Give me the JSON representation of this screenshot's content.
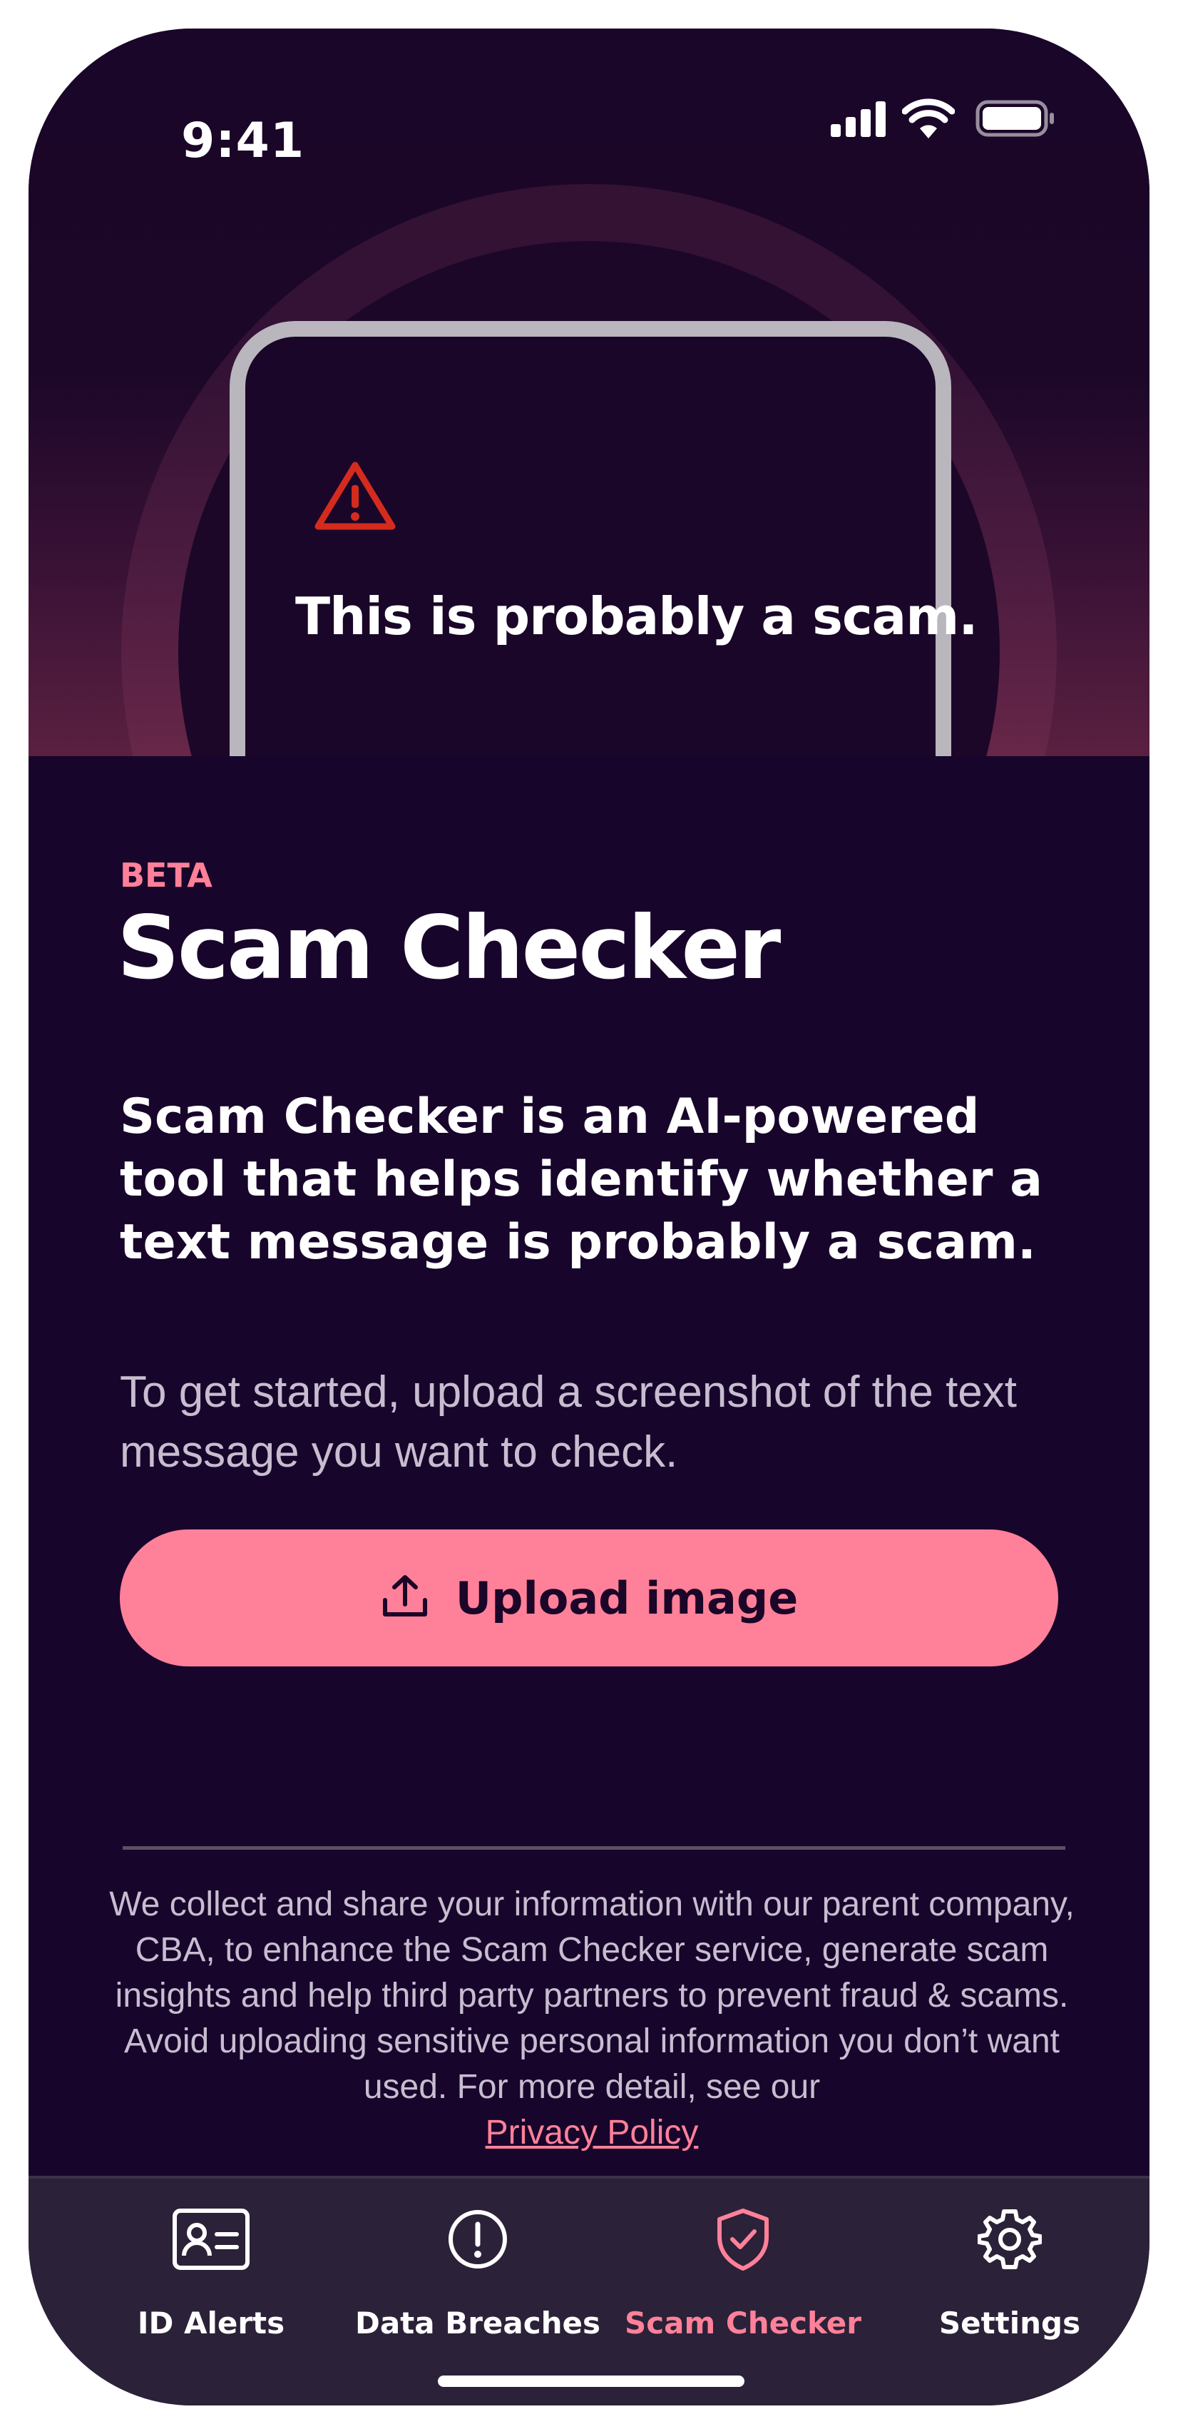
{
  "status_bar": {
    "time": "9:41"
  },
  "hero": {
    "message": "This is probably a scam."
  },
  "content": {
    "badge": "BETA",
    "title": "Scam Checker",
    "description": "Scam Checker is an AI-powered tool that helps identify whether a text message is probably a scam.",
    "instructions": "To get started, upload a screenshot of the text message you want to check.",
    "upload_label": "Upload image",
    "legal_text": "We collect and share your information with our parent company, CBA, to enhance the Scam Checker service, generate scam insights and help third party partners to prevent fraud & scams. Avoid uploading sensitive personal information you don’t want used. For more detail, see our",
    "privacy_link": "Privacy Policy"
  },
  "tabs": [
    {
      "label": "ID Alerts",
      "icon": "id-card-icon",
      "active": false
    },
    {
      "label": "Data Breaches",
      "icon": "alert-circle-icon",
      "active": false
    },
    {
      "label": "Scam Checker",
      "icon": "shield-check-icon",
      "active": true
    },
    {
      "label": "Settings",
      "icon": "gear-icon",
      "active": false
    }
  ],
  "colors": {
    "background": "#18052b",
    "accent": "#ff8199",
    "tab_bar": "#2b2138",
    "warning": "#d42b1e"
  }
}
